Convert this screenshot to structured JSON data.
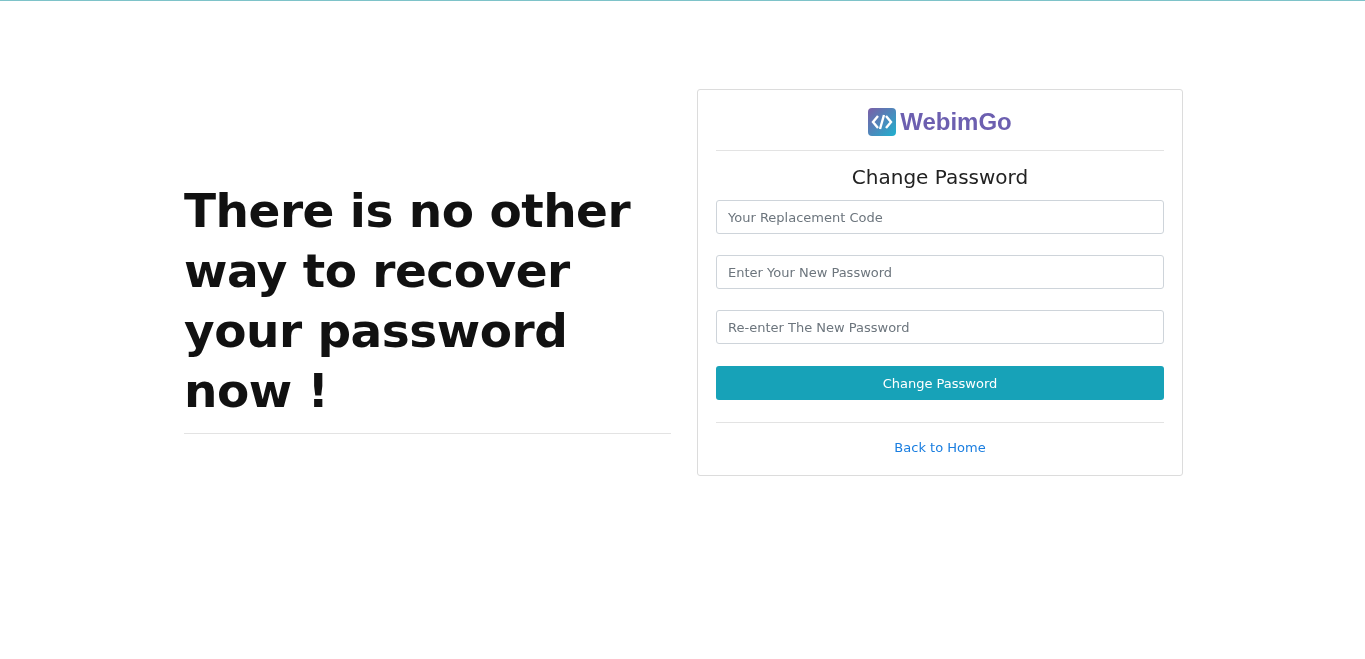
{
  "headline": "There is no other way to recover your password now !",
  "card": {
    "logo": "WebimGo",
    "title": "Change Password",
    "fields": [
      {
        "placeholder": "Your Replacement Code"
      },
      {
        "placeholder": "Enter Your New Password"
      },
      {
        "placeholder": "Re-enter The New Password"
      }
    ],
    "submit": "Change Password",
    "link": "Back to Home"
  }
}
